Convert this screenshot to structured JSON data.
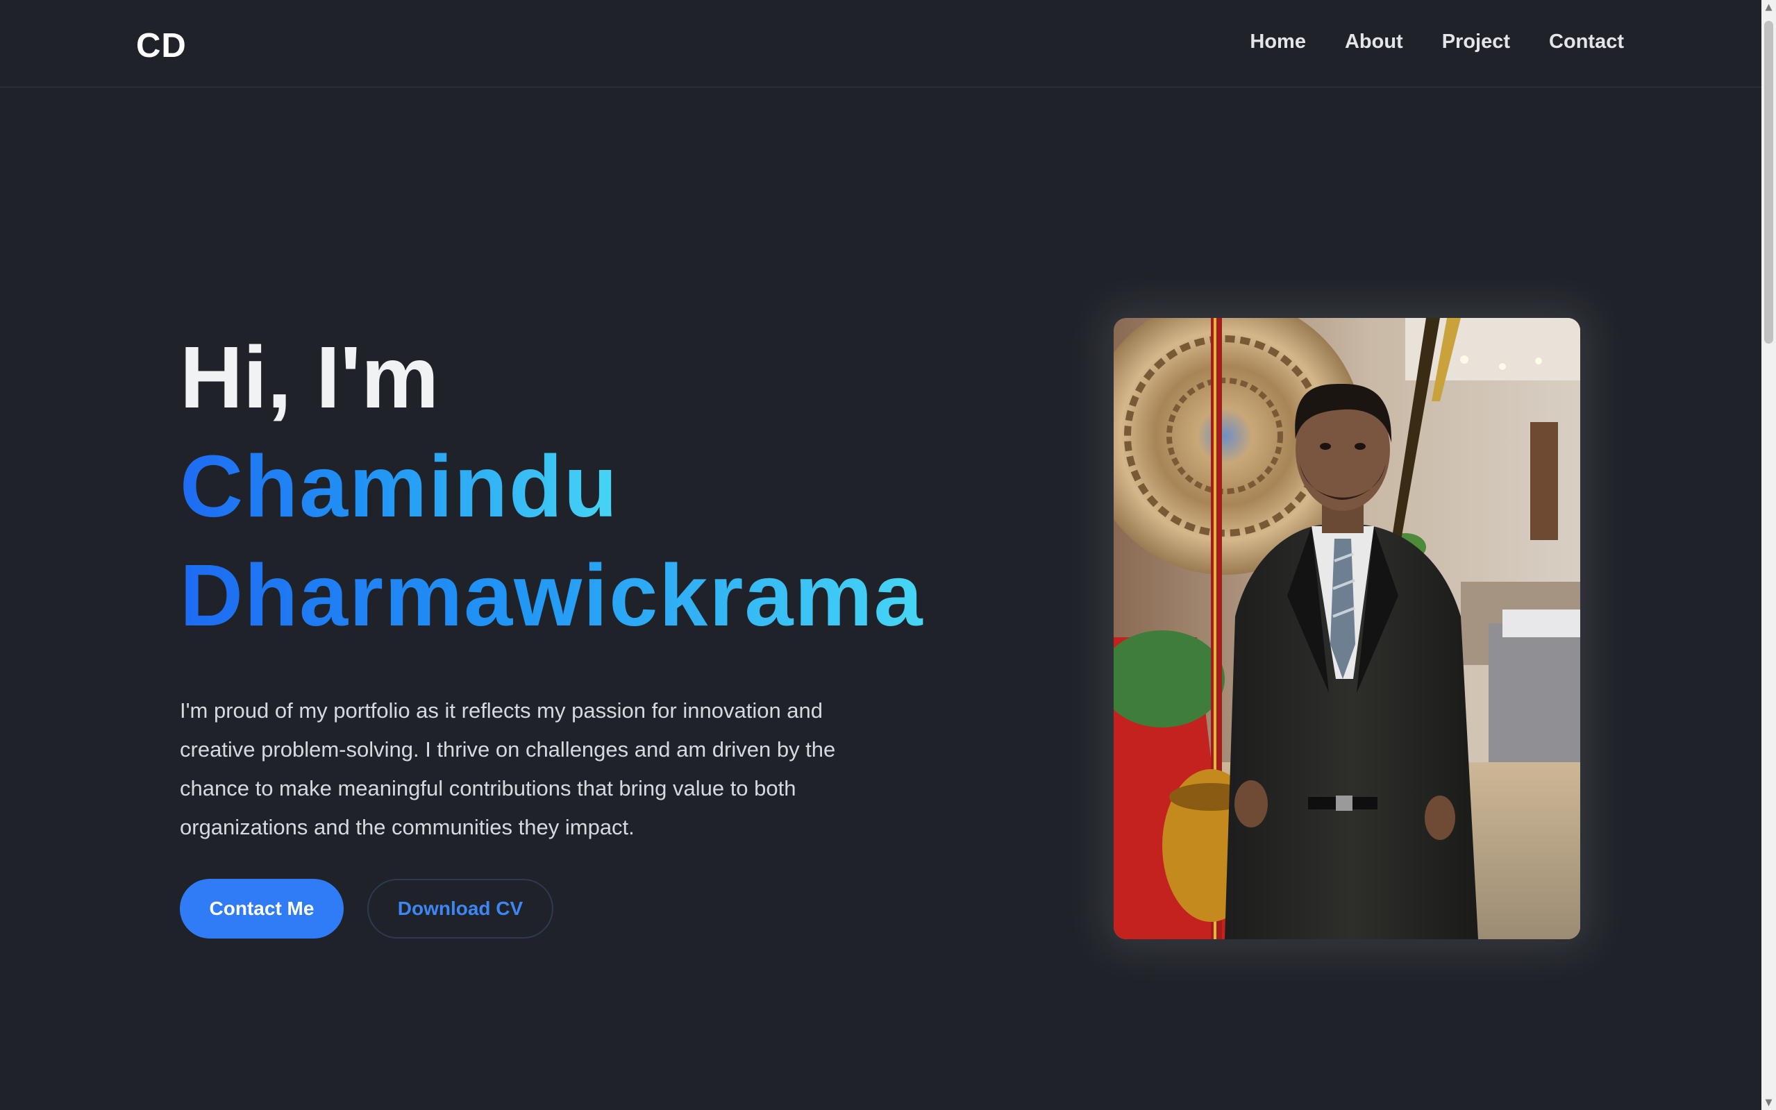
{
  "header": {
    "logo": "CD",
    "nav": [
      "Home",
      "About",
      "Project",
      "Contact"
    ]
  },
  "hero": {
    "greeting": "Hi, I'm",
    "name_first": "Chamindu",
    "name_last": "Dharmawickrama",
    "intro": "I'm proud of my portfolio as it reflects my passion for innovation and creative problem-solving. I thrive on challenges and am driven by the chance to make meaningful contributions that bring value to both organizations and the communities they impact.",
    "primary_button": "Contact Me",
    "secondary_button": "Download CV"
  },
  "colors": {
    "background": "#1f2228",
    "accent": "#2f7cf6",
    "gradient_start": "#1e6bf2",
    "gradient_end": "#47d6f5"
  },
  "icons": {
    "scroll_up": "triangle-up-icon",
    "scroll_down": "triangle-down-icon"
  }
}
